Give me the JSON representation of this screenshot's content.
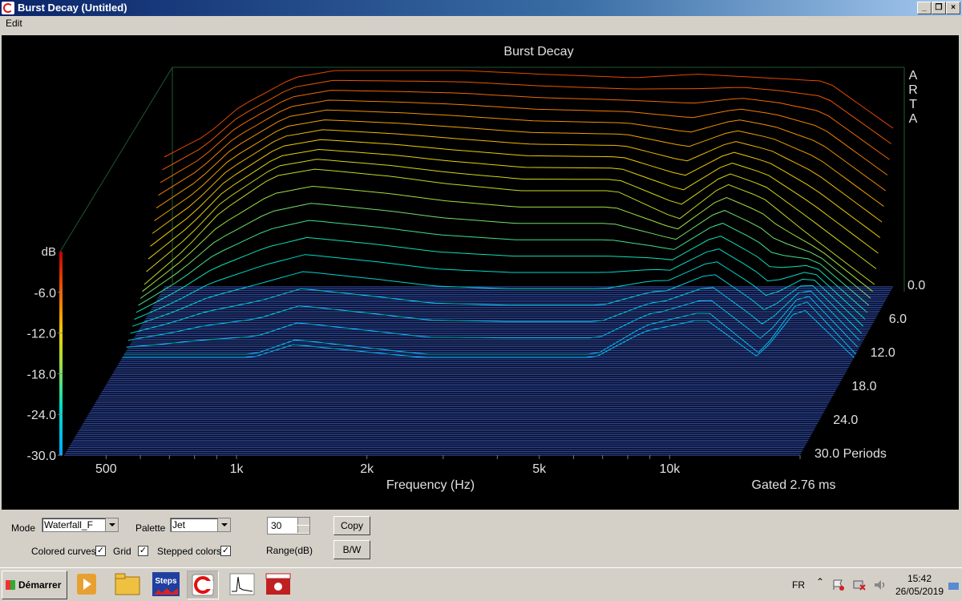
{
  "window": {
    "title": "Burst Decay  (Untitled)"
  },
  "menu": {
    "edit": "Edit"
  },
  "plot": {
    "title": "Burst Decay",
    "watermark": [
      "A",
      "R",
      "T",
      "A"
    ],
    "db_label": "dB",
    "db_ticks": [
      "-6.0",
      "-12.0",
      "-18.0",
      "-24.0",
      "-30.0"
    ],
    "freq_ticks": [
      {
        "label": "500",
        "hz": 500
      },
      {
        "label": "1k",
        "hz": 1000
      },
      {
        "label": "2k",
        "hz": 2000
      },
      {
        "label": "5k",
        "hz": 5000
      },
      {
        "label": "10k",
        "hz": 10000
      }
    ],
    "x_axis_label": "Frequency (Hz)",
    "period_ticks": [
      "0.0",
      "6.0",
      "12.0",
      "18.0",
      "24.0",
      "30.0 Periods"
    ],
    "gated": "Gated 2.76 ms"
  },
  "chart_data": {
    "type": "waterfall",
    "title": "Burst Decay",
    "xlabel": "Frequency (Hz)",
    "zlabel": "dB",
    "xlim": [
      400,
      20000
    ],
    "ylim": [
      0,
      30
    ],
    "zlim": [
      -30,
      0
    ],
    "x_scale": "log",
    "palette": "Jet",
    "series": [
      {
        "period": 0,
        "points": [
          [
            400,
            -12
          ],
          [
            500,
            -9
          ],
          [
            600,
            -5
          ],
          [
            800,
            -1
          ],
          [
            1000,
            0
          ],
          [
            1500,
            0
          ],
          [
            2000,
            0
          ],
          [
            3000,
            -0.5
          ],
          [
            5000,
            -1
          ],
          [
            7000,
            -0.5
          ],
          [
            10000,
            -1
          ],
          [
            14000,
            -1.5
          ],
          [
            20000,
            -8
          ]
        ]
      },
      {
        "period": 6,
        "points": [
          [
            400,
            -25
          ],
          [
            500,
            -20
          ],
          [
            600,
            -15
          ],
          [
            800,
            -10
          ],
          [
            1000,
            -9
          ],
          [
            1500,
            -10
          ],
          [
            2000,
            -11
          ],
          [
            3000,
            -12
          ],
          [
            5000,
            -12
          ],
          [
            7000,
            -16
          ],
          [
            9000,
            -11
          ],
          [
            11000,
            -13
          ],
          [
            14000,
            -18
          ],
          [
            20000,
            -25
          ]
        ]
      },
      {
        "period": 12,
        "points": [
          [
            400,
            -30
          ],
          [
            500,
            -30
          ],
          [
            800,
            -30
          ],
          [
            1000,
            -28
          ],
          [
            2000,
            -30
          ],
          [
            3000,
            -30
          ],
          [
            5000,
            -30
          ],
          [
            6500,
            -26
          ],
          [
            9000,
            -24
          ],
          [
            12000,
            -30
          ],
          [
            15000,
            -22
          ],
          [
            20000,
            -30
          ]
        ]
      },
      {
        "period": 18,
        "points": [
          [
            400,
            -30
          ],
          [
            20000,
            -30
          ]
        ]
      },
      {
        "period": 24,
        "points": [
          [
            400,
            -30
          ],
          [
            20000,
            -30
          ]
        ]
      },
      {
        "period": 30,
        "points": [
          [
            400,
            -30
          ],
          [
            20000,
            -30
          ]
        ]
      }
    ]
  },
  "controls": {
    "mode_label": "Mode",
    "mode_value": "Waterfall_F",
    "palette_label": "Palette",
    "palette_value": "Jet",
    "range_value": "30",
    "range_label": "Range(dB)",
    "copy": "Copy",
    "bw": "B/W",
    "colored_curves": "Colored curves",
    "grid": "Grid",
    "stepped_colors": "Stepped colors",
    "check": "✓"
  },
  "taskbar": {
    "start": "Démarrer",
    "steps": "Steps",
    "lang": "FR",
    "time": "15:42",
    "date": "26/05/2019"
  }
}
